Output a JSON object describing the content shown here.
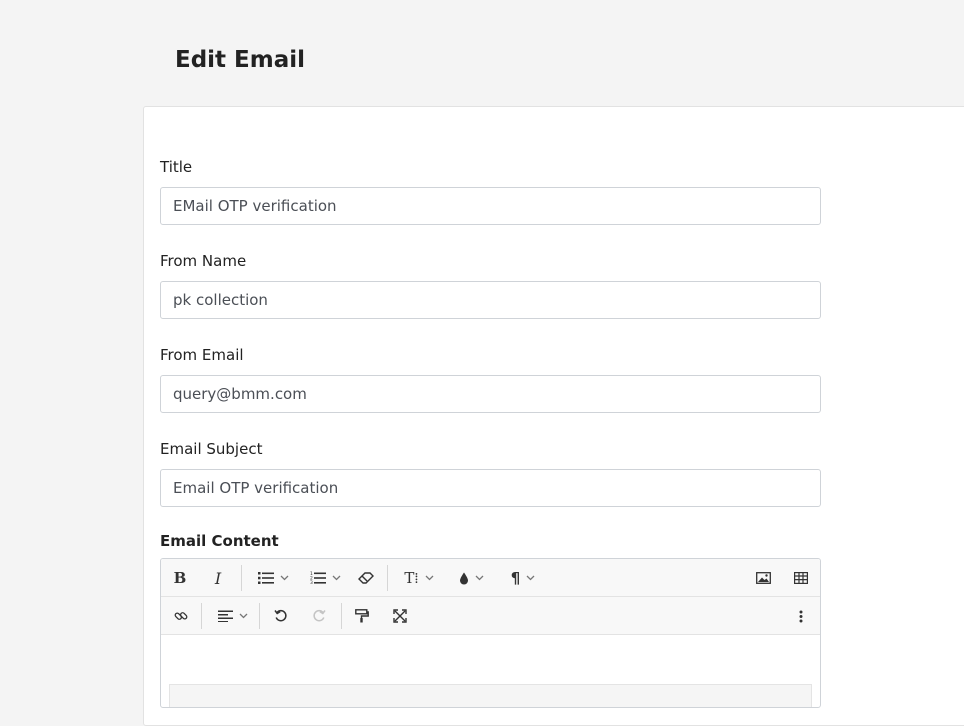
{
  "page": {
    "title": "Edit Email"
  },
  "form": {
    "title_label": "Title",
    "title_value": "EMail OTP verification",
    "from_name_label": "From Name",
    "from_name_value": "pk collection",
    "from_email_label": "From Email",
    "from_email_value": "query@bmm.com",
    "subject_label": "Email Subject",
    "subject_value": "Email OTP verification",
    "content_label": "Email Content"
  },
  "editor": {
    "toolbar": {
      "bold_glyph": "B",
      "italic_glyph": "I",
      "font_size_glyph": "T⁞",
      "paragraph_glyph": "¶",
      "icons": [
        "bold-icon",
        "italic-icon",
        "unordered-list-icon",
        "ordered-list-icon",
        "eraser-icon",
        "font-size-icon",
        "color-drop-icon",
        "paragraph-icon",
        "image-icon",
        "table-icon",
        "link-icon",
        "align-left-icon",
        "undo-icon",
        "redo-icon",
        "format-painter-icon",
        "fullscreen-icon",
        "more-vertical-icon"
      ]
    }
  }
}
